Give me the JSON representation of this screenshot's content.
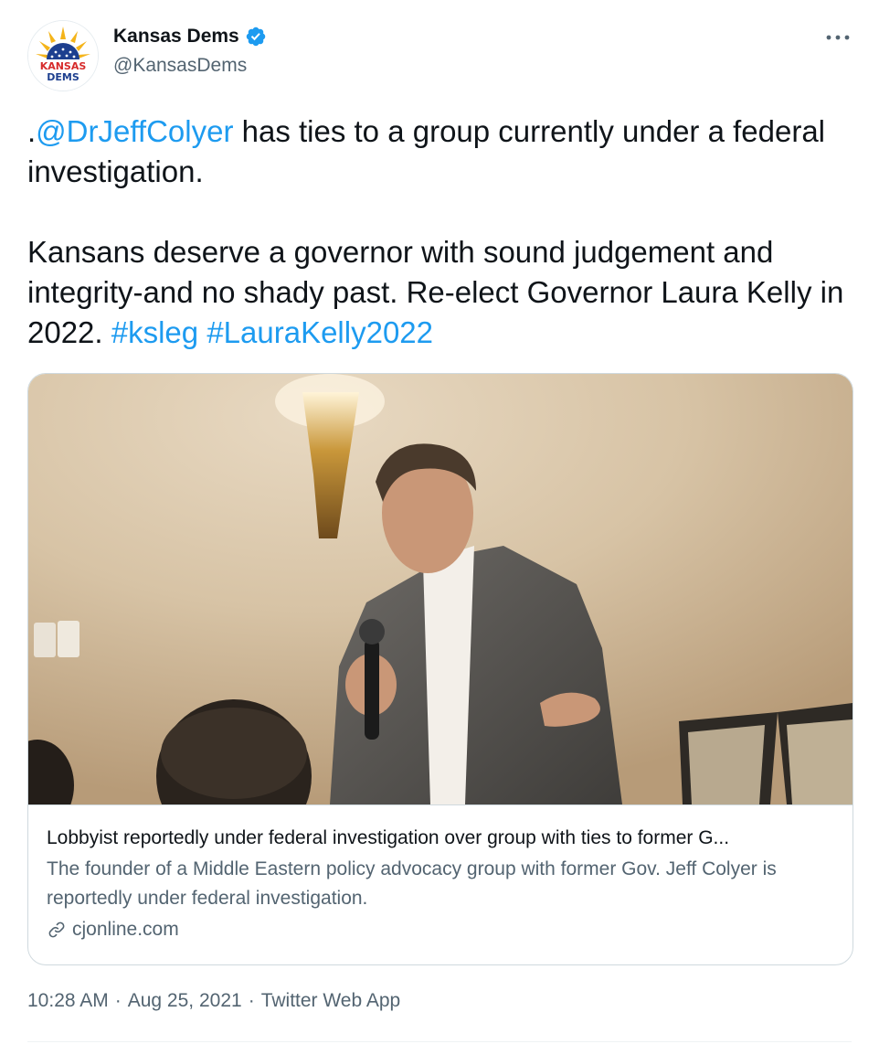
{
  "author": {
    "name": "Kansas Dems",
    "handle": "@KansasDems",
    "avatar_text_top": "KANSAS",
    "avatar_text_bottom": "DEMS",
    "verified": true
  },
  "tweet": {
    "mention": "@DrJeffColyer",
    "lead_dot": ".",
    "p1_rest": " has ties to a group currently under a federal investigation.",
    "p2": "Kansans deserve a governor with sound judgement and integrity-and no shady past. Re-elect Governor Laura Kelly in 2022. ",
    "hashtag1": "#ksleg",
    "hashtag2": "#LauraKelly2022"
  },
  "card": {
    "title": "Lobbyist reportedly under federal investigation over group with ties to former G...",
    "description": "The founder of a Middle Eastern policy advocacy group with former Gov. Jeff Colyer is reportedly under federal investigation.",
    "domain": "cjonline.com",
    "image_description_icon": "photo-of-speaker-with-microphone"
  },
  "meta": {
    "time": "10:28 AM",
    "date": "Aug 25, 2021",
    "separator": "·",
    "source": "Twitter Web App"
  },
  "colors": {
    "link": "#1d9bf0",
    "secondary_text": "#536471",
    "primary_text": "#0f1419",
    "border": "#cfd9de"
  }
}
